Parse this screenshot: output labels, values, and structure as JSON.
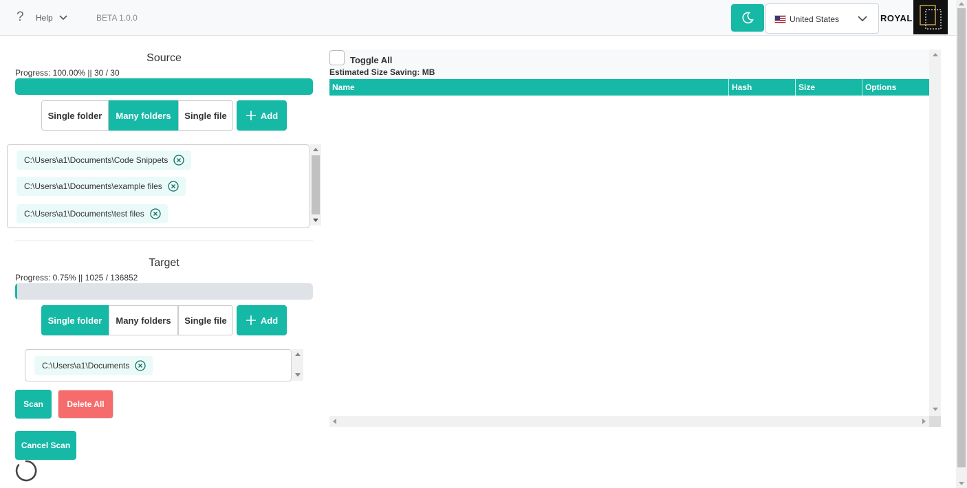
{
  "header": {
    "help_label": "Help",
    "version": "BETA 1.0.0",
    "country": "United States",
    "logo_text": "ROYAL"
  },
  "source": {
    "title": "Source",
    "progress_text": "Progress: 100.00% || 30 / 30",
    "progress_percent": 100,
    "modes": [
      "Single folder",
      "Many folders",
      "Single file"
    ],
    "active_mode": "Many folders",
    "add_label": "Add",
    "paths": [
      "C:\\Users\\a1\\Documents\\Code Snippets",
      "C:\\Users\\a1\\Documents\\example files",
      "C:\\Users\\a1\\Documents\\test files"
    ]
  },
  "target": {
    "title": "Target",
    "progress_text": "Progress: 0.75% || 1025 / 136852",
    "progress_percent": 0.75,
    "modes": [
      "Single folder",
      "Many folders",
      "Single file"
    ],
    "active_mode": "Single folder",
    "add_label": "Add",
    "paths": [
      "C:\\Users\\a1\\Documents"
    ]
  },
  "actions": {
    "scan_label": "Scan",
    "delete_all_label": "Delete All",
    "cancel_scan_label": "Cancel Scan"
  },
  "results": {
    "toggle_all_label": "Toggle All",
    "estimated_label": "Estimated Size Saving: MB",
    "columns": [
      "Name",
      "Hash",
      "Size",
      "Options"
    ]
  },
  "colors": {
    "accent": "#16b8a6",
    "danger": "#f66b6b"
  }
}
